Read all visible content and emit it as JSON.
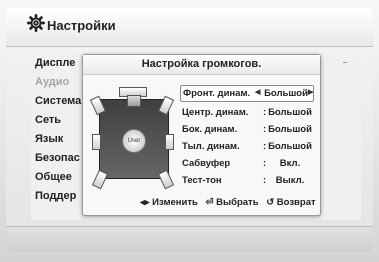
{
  "header": {
    "title": "Настройки",
    "icon": "gear-icon"
  },
  "menu": [
    {
      "label": "Диспле",
      "dim": false
    },
    {
      "label": "Аудио",
      "dim": true
    },
    {
      "label": "Система",
      "dim": false
    },
    {
      "label": "Сеть",
      "dim": false
    },
    {
      "label": "Язык",
      "dim": false
    },
    {
      "label": "Безопас",
      "dim": false
    },
    {
      "label": "Общее",
      "dim": false
    },
    {
      "label": "Поддер",
      "dim": false
    }
  ],
  "dialog": {
    "title": "Настройка громкогов.",
    "user_label": "User",
    "rows": [
      {
        "label": "Фронт. динам.",
        "value": "Большой"
      },
      {
        "label": "Центр. динам.",
        "value": "Большой"
      },
      {
        "label": "Бок. динам.",
        "value": "Большой"
      },
      {
        "label": "Тыл. динам.",
        "value": "Большой"
      },
      {
        "label": "Сабвуфер",
        "value": "Вкл."
      },
      {
        "label": "Тест-тон",
        "value": "Выкл."
      }
    ],
    "hints": {
      "change": "◂▸ Изменить",
      "select": "⏎ Выбрать",
      "back": "↺ Возврат"
    }
  }
}
